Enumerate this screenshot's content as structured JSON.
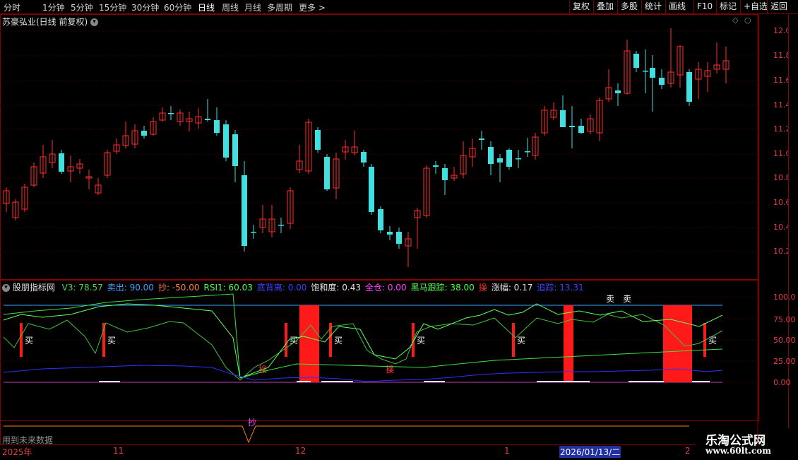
{
  "toolbar": {
    "periods": [
      "分时",
      "1分钟",
      "5分钟",
      "15分钟",
      "30分钟",
      "60分钟",
      "日线",
      "周线",
      "月线",
      "多周期",
      "更多 >"
    ],
    "active_period": "日线",
    "right_buttons": [
      "复权",
      "叠加",
      "多股",
      "统计",
      "画线",
      "F10",
      "标记",
      "+自选",
      "返回"
    ]
  },
  "main_pane": {
    "title": "苏豪弘业(日线 前复权)",
    "y_ticks": [
      "12.00",
      "11.80",
      "11.60",
      "11.40",
      "11.20",
      "11.00",
      "10.80",
      "10.60",
      "10.40",
      "10.20"
    ]
  },
  "indicator_pane": {
    "name": "股朋指标网",
    "values": [
      {
        "label": "V3:",
        "value": "78.57",
        "color": "#50d050"
      },
      {
        "label": "卖出:",
        "value": "90.00",
        "color": "#40a0ff"
      },
      {
        "label": "抄:",
        "value": "-50.00",
        "color": "#ff8040"
      },
      {
        "label": "RSI1:",
        "value": "60.03",
        "color": "#50ff50"
      },
      {
        "label": "底背离:",
        "value": "0.00",
        "color": "#4040ff"
      },
      {
        "label": "饱和度:",
        "value": "0.43",
        "color": "#e0e0e0"
      },
      {
        "label": "全仓:",
        "value": "0.00",
        "color": "#ff40ff"
      },
      {
        "label": "黑马跟踪:",
        "value": "38.00",
        "color": "#50ff50"
      },
      {
        "label": "操",
        "value": "",
        "color": "#ff3030"
      },
      {
        "label": "涨幅:",
        "value": "0.17",
        "color": "#e0e0e0"
      },
      {
        "label": "追踪:",
        "value": "13.31",
        "color": "#4040ff"
      }
    ],
    "y_ticks": [
      "100.0",
      "75.00",
      "50.00",
      "25.00",
      "0.00"
    ],
    "signal_buy": "买",
    "signal_sell": "卖",
    "signal_operate": "操"
  },
  "bottom_pane": {
    "note": "用到未来数据",
    "signal_chao": "抄"
  },
  "date_axis": {
    "labels": [
      "2025年",
      "11",
      "12",
      "1",
      "2026/01/13/二",
      "2"
    ]
  },
  "watermark": {
    "name": "乐淘公式网",
    "url": "www.60lt.com"
  },
  "colors": {
    "up": "#ff3030",
    "down": "#40e0e0",
    "bg": "#000000",
    "frame": "#8b0000"
  }
}
